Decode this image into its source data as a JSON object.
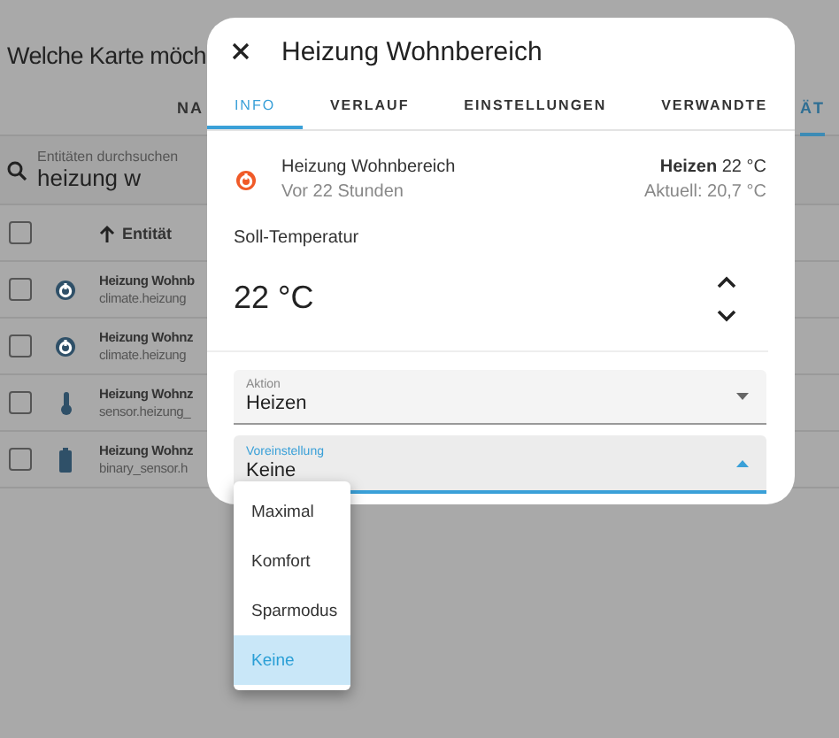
{
  "page": {
    "title": "Welche Karte möch",
    "tabs": [
      {
        "label": "NA",
        "selected": false
      },
      {
        "label": "ÄT",
        "selected": true
      }
    ],
    "search": {
      "placeholder": "Entitäten durchsuchen",
      "value": "heizung w"
    },
    "table": {
      "header": "Entität",
      "all_checked": false,
      "rows": [
        {
          "kind": "climate",
          "name": "Heizung Wohnb",
          "id": "climate.heizung",
          "checked": false
        },
        {
          "kind": "climate",
          "name": "Heizung Wohnz",
          "id": "climate.heizung",
          "checked": false
        },
        {
          "kind": "sensor",
          "name": "Heizung Wohnz",
          "id": "sensor.heizung_",
          "checked": false
        },
        {
          "kind": "battery",
          "name": "Heizung Wohnz",
          "id": "binary_sensor.h",
          "checked": false
        }
      ]
    }
  },
  "dialog": {
    "title": "Heizung Wohnbereich",
    "tabs": [
      {
        "label": "INFO",
        "selected": true
      },
      {
        "label": "VERLAUF",
        "selected": false
      },
      {
        "label": "EINSTELLUNGEN",
        "selected": false
      },
      {
        "label": "VERWANDTE",
        "selected": false
      }
    ],
    "entity": {
      "name": "Heizung Wohnbereich",
      "time": "Vor 22 Stunden",
      "state": "Heizen",
      "target": "22 °C",
      "current": "Aktuell: 20,7 °C"
    },
    "setpoint": {
      "label": "Soll-Temperatur",
      "value": "22 °C"
    },
    "fields": [
      {
        "label": "Aktion",
        "value": "Heizen",
        "open": false
      },
      {
        "label": "Voreinstellung",
        "value": "Keine",
        "open": true
      }
    ],
    "menu": [
      {
        "label": "Maximal",
        "selected": false
      },
      {
        "label": "Komfort",
        "selected": false
      },
      {
        "label": "Sparmodus",
        "selected": false
      },
      {
        "label": "Keine",
        "selected": true
      }
    ]
  }
}
